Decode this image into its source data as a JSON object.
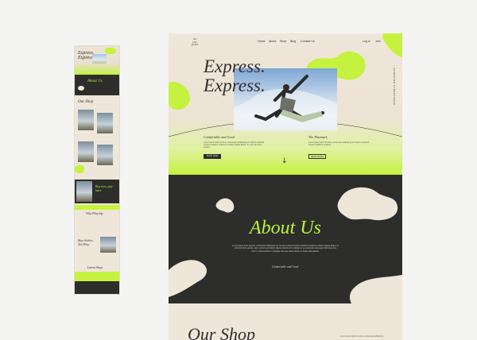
{
  "mini_preview": {
    "hero_title": "Express.\nExpress.",
    "about_title": "About Us",
    "shop_title": "Our Shop",
    "banner_text": "Buy now, pay later.",
    "why_title": "Why Play big",
    "quote_text": "Buy clothes, Not Play",
    "gallery_title": "Latest Shop"
  },
  "header": {
    "logo_text": "the\nplay\nground",
    "nav": [
      "Home",
      "About",
      "Shop",
      "Blog",
      "Contact Us"
    ],
    "nav_right": [
      "Log in",
      "Join"
    ],
    "vertical_text": "+ CURRATED STREETWEAR"
  },
  "hero": {
    "headline": "Express.\nExpress.",
    "col1_title": "Comfortable and Good.",
    "col1_text": "Lorem ipsum dolor sit amet, consectetur adipiscing elit. Sed do eiusmod tempor incididunt ut labore et dolore magna aliqua. Ut enim ad minim veniam.",
    "col2_title": "The Playmark",
    "col2_text": "Lorem ipsum dolor sit amet, consectetur adipiscing elit. Sed do eiusmod tempor incididunt ut labore.",
    "btn_primary": "SHOP NOW",
    "btn_secondary": "READ MORE",
    "arrow": "↓"
  },
  "about": {
    "title": "About Us",
    "text": "Lorem ipsum dolor sit amet, consectetur adipiscing elit. Sed do eiusmod tempor incididunt ut labore et dolore magna aliqua. Ut enim ad minim veniam, quis nostrud exercitation ullamco laboris nisi ut aliquip ex ea commodo consequat. Duis aute irure dolor in reprehenderit in voluptate velit esse cillum dolore eu fugiat nulla pariatur.",
    "subtitle": "Comfortable and Good."
  },
  "shop": {
    "title": "Our Shop",
    "note": "Lorem ipsum dolor sit amet, consectetur adipiscing."
  },
  "colors": {
    "lime": "#c5f23e",
    "lime_text": "#b8f53a",
    "dark": "#2d2d2b",
    "cream": "#efe6da",
    "canvas": "#f4f4f3"
  }
}
